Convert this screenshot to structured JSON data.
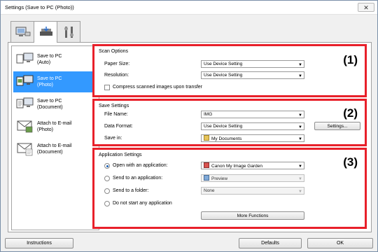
{
  "window": {
    "title": "Settings (Save to PC (Photo))",
    "close_label": "✕"
  },
  "tabs": [
    {
      "name": "scan-from-computer-tab",
      "icon": "scanner-computer-icon"
    },
    {
      "name": "scan-from-panel-tab",
      "icon": "scanner-icon"
    },
    {
      "name": "general-settings-tab",
      "icon": "tools-icon"
    }
  ],
  "sidebar": {
    "items": [
      {
        "line1": "Save to PC",
        "line2": "(Auto)"
      },
      {
        "line1": "Save to PC",
        "line2": "(Photo)"
      },
      {
        "line1": "Save to PC",
        "line2": "(Document)"
      },
      {
        "line1": "Attach to E-mail",
        "line2": "(Photo)"
      },
      {
        "line1": "Attach to E-mail",
        "line2": "(Document)"
      }
    ],
    "selected_index": 1
  },
  "scan_options": {
    "title": "Scan Options",
    "number": "(1)",
    "paper_size_label": "Paper Size:",
    "paper_size_value": "Use Device Setting",
    "resolution_label": "Resolution:",
    "resolution_value": "Use Device Setting",
    "compress_label": "Compress scanned images upon transfer"
  },
  "save_settings": {
    "title": "Save Settings",
    "number": "(2)",
    "file_name_label": "File Name:",
    "file_name_value": "IMG",
    "data_format_label": "Data Format:",
    "data_format_value": "Use Device Setting",
    "settings_button": "Settings...",
    "save_in_label": "Save in:",
    "save_in_value": "My Documents"
  },
  "application_settings": {
    "title": "Application Settings",
    "number": "(3)",
    "open_with_label": "Open with an application:",
    "open_with_value": "Canon My Image Garden",
    "send_to_app_label": "Send to an application:",
    "send_to_app_value": "Preview",
    "send_to_folder_label": "Send to a folder:",
    "send_to_folder_value": "None",
    "do_not_start_label": "Do not start any application",
    "more_functions_button": "More Functions"
  },
  "footer": {
    "instructions": "Instructions",
    "defaults": "Defaults",
    "ok": "OK"
  },
  "colors": {
    "accent": "#3399ff",
    "highlight_border": "#e8202a"
  }
}
